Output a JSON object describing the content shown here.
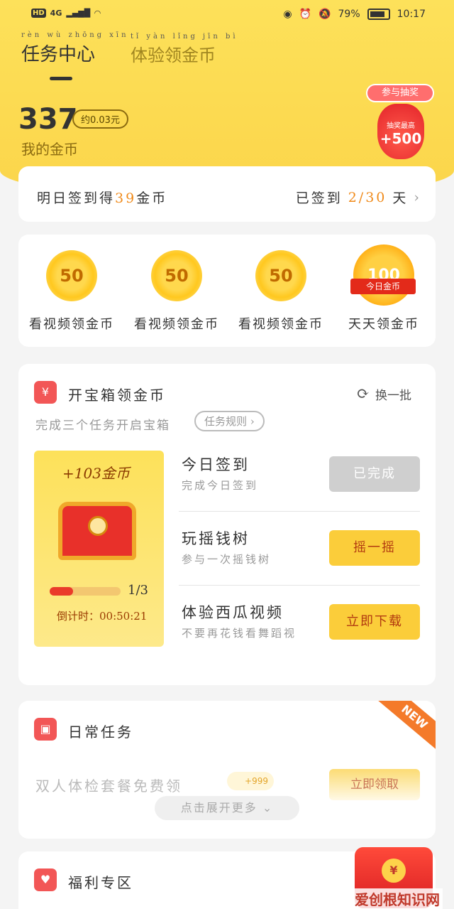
{
  "status_bar": {
    "network": "HD",
    "signal": "4G",
    "battery": "79%",
    "time": "10:17"
  },
  "tabs": [
    {
      "label": "任务中心",
      "pinyin": "rèn wù zhōng xīn"
    },
    {
      "label": "体验领金币",
      "pinyin": "tǐ yàn lǐng jīn bì"
    }
  ],
  "coins": {
    "value": "337",
    "approx": "约0.03元",
    "label": "我的金币"
  },
  "lottery": {
    "pill": "参与抽奖",
    "caption": "抽奖最高",
    "amount": "+500"
  },
  "signin": {
    "text_prefix": "明日签到得",
    "coins": "39",
    "text_suffix": "金币",
    "status_prefix": "已签到",
    "days": "2/30",
    "status_suffix": "天"
  },
  "watch_items": [
    {
      "value": "50",
      "label": "看视频领金币"
    },
    {
      "value": "50",
      "label": "看视频领金币"
    },
    {
      "value": "50",
      "label": "看视频领金币"
    },
    {
      "value": "100",
      "ribbon": "今日金币",
      "label": "天天领金币"
    }
  ],
  "chest": {
    "title": "开宝箱领金币",
    "subtitle": "完成三个任务开启宝箱",
    "rules": "任务规则",
    "refresh": "换一批",
    "reward": "+103金币",
    "progress": 0.33,
    "progress_text": "1/3",
    "countdown": "倒计时：00:50:21",
    "tasks": [
      {
        "name": "今日签到",
        "desc": "完成今日签到",
        "button": "已完成",
        "state": "done"
      },
      {
        "name": "玩摇钱树",
        "desc": "参与一次摇钱树",
        "button": "摇一摇",
        "state": "go"
      },
      {
        "name": "体验西瓜视频",
        "desc": "不要再花钱看舞蹈视",
        "button": "立即下载",
        "state": "go"
      }
    ]
  },
  "daily": {
    "title": "日常任务",
    "new_tag": "NEW",
    "task": "双人体检套餐免费领",
    "reward": "+999",
    "button": "立即领取",
    "expand": "点击展开更多"
  },
  "welfare": {
    "title": "福利专区"
  },
  "watermark": "爱创根知识网"
}
